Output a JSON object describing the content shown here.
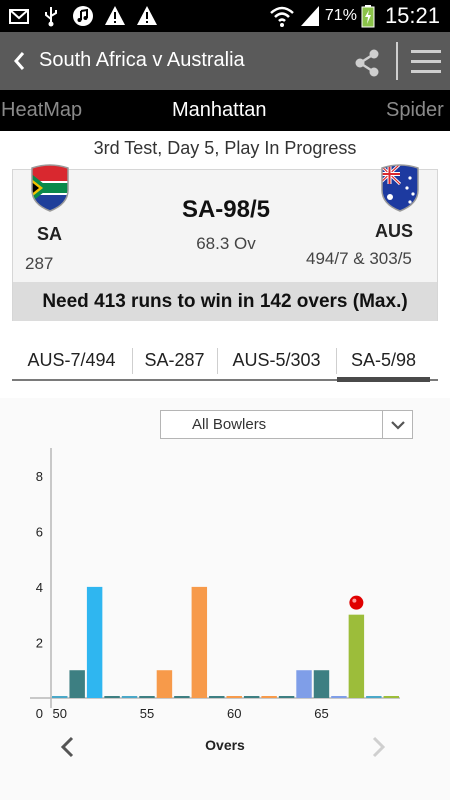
{
  "status_bar": {
    "battery_percent": "71%",
    "time": "15:21",
    "icons": [
      "mail-icon",
      "usb-icon",
      "music-icon",
      "warning-icon",
      "warning-icon",
      "wifi-icon",
      "signal-icon",
      "battery-icon"
    ]
  },
  "app_bar": {
    "title": "South Africa v Australia",
    "icons": [
      "back-icon",
      "share-icon",
      "menu-icon"
    ]
  },
  "view_tabs": [
    "HeatMap",
    "Manhattan",
    "Spider"
  ],
  "active_view_tab": "Manhattan",
  "match_status": "3rd Test, Day 5, Play In Progress",
  "scorecard": {
    "home": {
      "abbr": "SA",
      "score": "287"
    },
    "away": {
      "abbr": "AUS",
      "score": "494/7 & 303/5"
    },
    "current_score": "SA-98/5",
    "overs": "68.3 Ov",
    "target_text": "Need 413 runs to win in 142 overs (Max.)"
  },
  "innings_tabs": [
    "AUS-7/494",
    "SA-287",
    "AUS-5/303",
    "SA-5/98"
  ],
  "active_innings": "SA-5/98",
  "filter": {
    "selected": "All Bowlers"
  },
  "chart_data": {
    "type": "bar",
    "xlabel": "Overs",
    "ylabel": "",
    "x_ticks": [
      50,
      55,
      60,
      65
    ],
    "y_ticks": [
      0,
      2,
      4,
      6,
      8
    ],
    "ylim": [
      0,
      9
    ],
    "xlim": [
      49.5,
      69.5
    ],
    "grid": false,
    "wicket_markers": [
      67
    ],
    "bars": [
      {
        "over": 50,
        "runs": 0,
        "color": "#4aa8c8"
      },
      {
        "over": 51,
        "runs": 1,
        "color": "#3d7f82"
      },
      {
        "over": 52,
        "runs": 4,
        "color": "#2fb6f0"
      },
      {
        "over": 53,
        "runs": 0,
        "color": "#3d7f82"
      },
      {
        "over": 54,
        "runs": 0,
        "color": "#4aa8c8"
      },
      {
        "over": 55,
        "runs": 0,
        "color": "#3d7f82"
      },
      {
        "over": 56,
        "runs": 1,
        "color": "#f79a4a"
      },
      {
        "over": 57,
        "runs": 0,
        "color": "#3d7f82"
      },
      {
        "over": 58,
        "runs": 4,
        "color": "#f79a4a"
      },
      {
        "over": 59,
        "runs": 0,
        "color": "#3d7f82"
      },
      {
        "over": 60,
        "runs": 0,
        "color": "#f79a4a"
      },
      {
        "over": 61,
        "runs": 0,
        "color": "#3d7f82"
      },
      {
        "over": 62,
        "runs": 0,
        "color": "#f79a4a"
      },
      {
        "over": 63,
        "runs": 0,
        "color": "#3d7f82"
      },
      {
        "over": 64,
        "runs": 1,
        "color": "#7f9ee8"
      },
      {
        "over": 65,
        "runs": 1,
        "color": "#3d7f82"
      },
      {
        "over": 66,
        "runs": 0,
        "color": "#7f9ee8"
      },
      {
        "over": 67,
        "runs": 3,
        "color": "#9cbd3a"
      },
      {
        "over": 68,
        "runs": 0,
        "color": "#4aa8c8"
      },
      {
        "over": 69,
        "runs": 0,
        "color": "#9cbd3a"
      }
    ]
  },
  "colors": {
    "app_bar": "#5a5a5a",
    "tab_strip": "#000000",
    "wicket_marker": "#e00000"
  }
}
